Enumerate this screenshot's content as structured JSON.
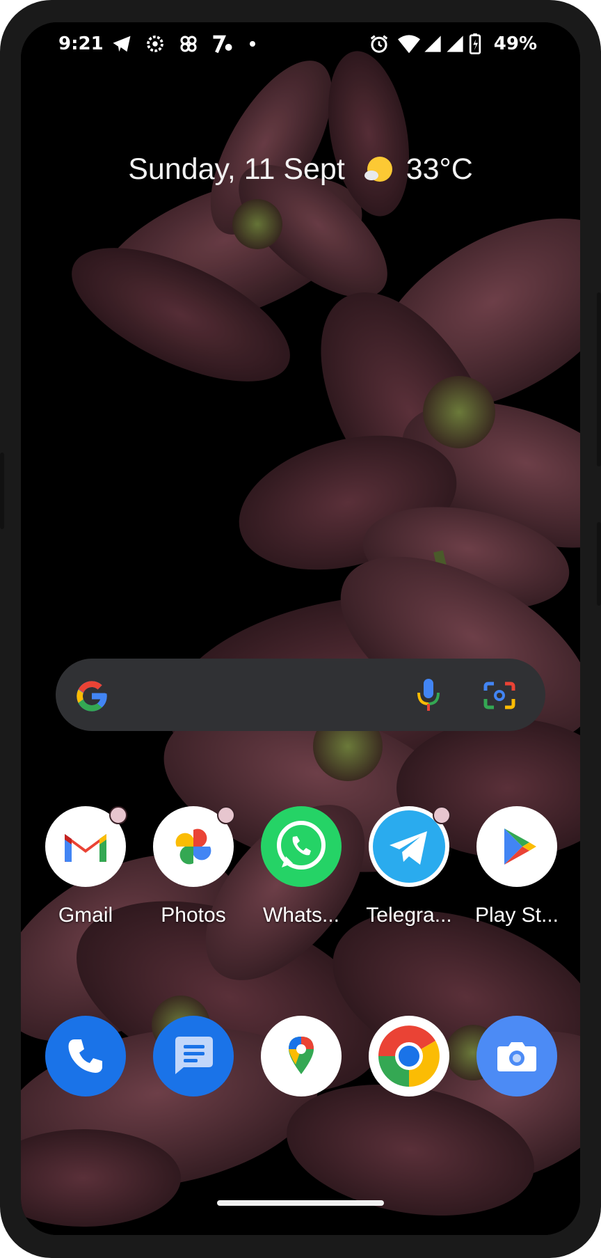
{
  "status_bar": {
    "time": "9:21",
    "battery_percent": "49%",
    "left_icons": [
      "telegram-icon",
      "settings-icon",
      "pinwheel-icon",
      "news-icon",
      "dot-icon"
    ],
    "right_icons": [
      "alarm-icon",
      "wifi-icon",
      "signal-icon",
      "signal-icon",
      "battery-icon"
    ]
  },
  "at_a_glance": {
    "date": "Sunday, 11 Sept",
    "temperature": "33°C",
    "weather_icon": "sunny-icon"
  },
  "search": {
    "icons": [
      "google-icon",
      "microphone-icon",
      "lens-icon"
    ]
  },
  "home_apps": [
    {
      "label": "Gmail",
      "icon": "gmail-icon",
      "badge": true
    },
    {
      "label": "Photos",
      "icon": "photos-icon",
      "badge": true
    },
    {
      "label": "Whats...",
      "icon": "whatsapp-icon",
      "badge": false
    },
    {
      "label": "Telegra...",
      "icon": "telegram-icon",
      "badge": true
    },
    {
      "label": "Play St...",
      "icon": "play-store-icon",
      "badge": false
    }
  ],
  "dock": [
    {
      "icon": "phone-icon"
    },
    {
      "icon": "messages-icon"
    },
    {
      "icon": "maps-icon"
    },
    {
      "icon": "chrome-icon"
    },
    {
      "icon": "camera-icon"
    }
  ],
  "colors": {
    "search_bg": "#303134",
    "badge": "#e7c6cf",
    "google_blue": "#4285F4",
    "google_red": "#EA4335",
    "google_yellow": "#FBBC04",
    "google_green": "#34A853",
    "whatsapp_green": "#25D366",
    "telegram_blue": "#2AABEE"
  }
}
